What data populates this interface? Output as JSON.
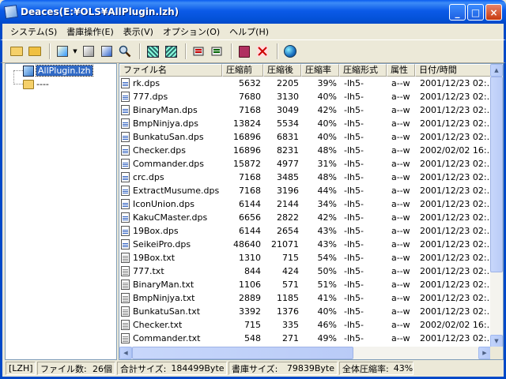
{
  "window": {
    "title": "Deaces(E:¥OLS¥AllPlugin.lzh)",
    "minimize": "_",
    "maximize": "□",
    "close": "×"
  },
  "menu": [
    {
      "label": "システム(S)"
    },
    {
      "label": "書庫操作(E)"
    },
    {
      "label": "表示(V)"
    },
    {
      "label": "オプション(O)"
    },
    {
      "label": "ヘルプ(H)"
    }
  ],
  "toolbar": {
    "icons": [
      "open-folder-icon",
      "open-folder-star-icon",
      "extract-icon",
      "dropdown-arrow-icon",
      "box-icon",
      "copy-icon",
      "search-icon",
      "select-grid-icon",
      "deselect-grid-icon",
      "tool-icon",
      "tool-alt-icon",
      "book-icon",
      "scissors-icon",
      "globe-icon"
    ],
    "drop_glyph": "▼"
  },
  "tree": {
    "root_label": "AllPlugin.lzh",
    "child_label": "----"
  },
  "list": {
    "columns": [
      "ファイル名",
      "圧縮前",
      "圧縮後",
      "圧縮率",
      "圧縮形式",
      "属性",
      "日付/時間"
    ],
    "rows": [
      {
        "name": "rk.dps",
        "type": "dps",
        "orig": "5632",
        "comp": "2205",
        "ratio": "39%",
        "method": "-lh5-",
        "attr": "a--w",
        "date": "2001/12/23 02:.."
      },
      {
        "name": "777.dps",
        "type": "dps",
        "orig": "7680",
        "comp": "3130",
        "ratio": "40%",
        "method": "-lh5-",
        "attr": "a--w",
        "date": "2001/12/23 02:.."
      },
      {
        "name": "BinaryMan.dps",
        "type": "dps",
        "orig": "7168",
        "comp": "3049",
        "ratio": "42%",
        "method": "-lh5-",
        "attr": "a--w",
        "date": "2001/12/23 02:.."
      },
      {
        "name": "BmpNinjya.dps",
        "type": "dps",
        "orig": "13824",
        "comp": "5534",
        "ratio": "40%",
        "method": "-lh5-",
        "attr": "a--w",
        "date": "2001/12/23 02:.."
      },
      {
        "name": "BunkatuSan.dps",
        "type": "dps",
        "orig": "16896",
        "comp": "6831",
        "ratio": "40%",
        "method": "-lh5-",
        "attr": "a--w",
        "date": "2001/12/23 02:.."
      },
      {
        "name": "Checker.dps",
        "type": "dps",
        "orig": "16896",
        "comp": "8231",
        "ratio": "48%",
        "method": "-lh5-",
        "attr": "a--w",
        "date": "2002/02/02 16:.."
      },
      {
        "name": "Commander.dps",
        "type": "dps",
        "orig": "15872",
        "comp": "4977",
        "ratio": "31%",
        "method": "-lh5-",
        "attr": "a--w",
        "date": "2001/12/23 02:.."
      },
      {
        "name": "crc.dps",
        "type": "dps",
        "orig": "7168",
        "comp": "3485",
        "ratio": "48%",
        "method": "-lh5-",
        "attr": "a--w",
        "date": "2001/12/23 02:.."
      },
      {
        "name": "ExtractMusume.dps",
        "type": "dps",
        "orig": "7168",
        "comp": "3196",
        "ratio": "44%",
        "method": "-lh5-",
        "attr": "a--w",
        "date": "2001/12/23 02:.."
      },
      {
        "name": "IconUnion.dps",
        "type": "dps",
        "orig": "6144",
        "comp": "2144",
        "ratio": "34%",
        "method": "-lh5-",
        "attr": "a--w",
        "date": "2001/12/23 02:.."
      },
      {
        "name": "KakuCMaster.dps",
        "type": "dps",
        "orig": "6656",
        "comp": "2822",
        "ratio": "42%",
        "method": "-lh5-",
        "attr": "a--w",
        "date": "2001/12/23 02:.."
      },
      {
        "name": "19Box.dps",
        "type": "dps",
        "orig": "6144",
        "comp": "2654",
        "ratio": "43%",
        "method": "-lh5-",
        "attr": "a--w",
        "date": "2001/12/23 02:.."
      },
      {
        "name": "SeikeiPro.dps",
        "type": "dps",
        "orig": "48640",
        "comp": "21071",
        "ratio": "43%",
        "method": "-lh5-",
        "attr": "a--w",
        "date": "2001/12/23 02:.."
      },
      {
        "name": "19Box.txt",
        "type": "txt",
        "orig": "1310",
        "comp": "715",
        "ratio": "54%",
        "method": "-lh5-",
        "attr": "a--w",
        "date": "2001/12/23 02:.."
      },
      {
        "name": "777.txt",
        "type": "txt",
        "orig": "844",
        "comp": "424",
        "ratio": "50%",
        "method": "-lh5-",
        "attr": "a--w",
        "date": "2001/12/23 02:.."
      },
      {
        "name": "BinaryMan.txt",
        "type": "txt",
        "orig": "1106",
        "comp": "571",
        "ratio": "51%",
        "method": "-lh5-",
        "attr": "a--w",
        "date": "2001/12/23 02:.."
      },
      {
        "name": "BmpNinjya.txt",
        "type": "txt",
        "orig": "2889",
        "comp": "1185",
        "ratio": "41%",
        "method": "-lh5-",
        "attr": "a--w",
        "date": "2001/12/23 02:.."
      },
      {
        "name": "BunkatuSan.txt",
        "type": "txt",
        "orig": "3392",
        "comp": "1376",
        "ratio": "40%",
        "method": "-lh5-",
        "attr": "a--w",
        "date": "2001/12/23 02:.."
      },
      {
        "name": "Checker.txt",
        "type": "txt",
        "orig": "715",
        "comp": "335",
        "ratio": "46%",
        "method": "-lh5-",
        "attr": "a--w",
        "date": "2002/02/02 16:.."
      },
      {
        "name": "Commander.txt",
        "type": "txt",
        "orig": "548",
        "comp": "271",
        "ratio": "49%",
        "method": "-lh5-",
        "attr": "a--w",
        "date": "2001/12/23 02:.."
      }
    ]
  },
  "status": {
    "format": "[LZH]",
    "file_count_label": "ファイル数:",
    "file_count": "26個",
    "total_size_label": "合計サイズ:",
    "total_size": "184499Byte",
    "archive_size_label": "書庫サイズ:",
    "archive_size": "79839Byte",
    "overall_ratio_label": "全体圧縮率:",
    "overall_ratio": "43%"
  },
  "colors": {
    "titlebar": "#0452d8",
    "selection": "#316ac5",
    "window_bg": "#ece9d8"
  }
}
